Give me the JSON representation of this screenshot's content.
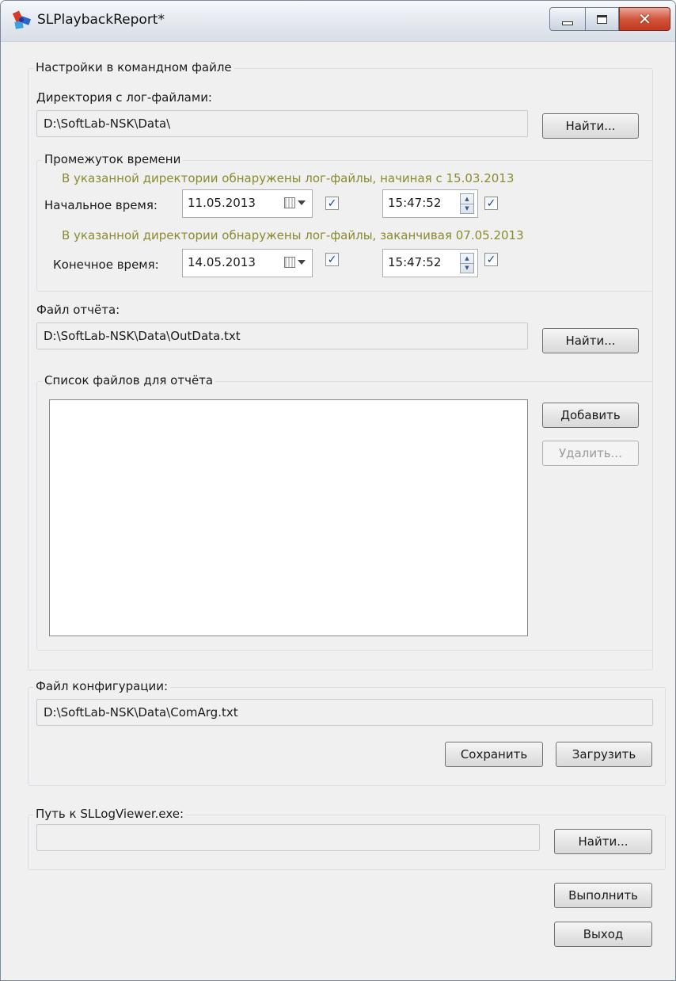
{
  "window": {
    "title": "SLPlaybackReport*"
  },
  "command_settings": {
    "legend": "Настройки в командном файле",
    "log_dir_label": "Директория с лог-файлами:",
    "log_dir_value": "D:\\SoftLab-NSK\\Data\\",
    "log_dir_browse": "Найти...",
    "time_range": {
      "legend": "Промежуток времени",
      "start_hint": "В указанной директории обнаружены лог-файлы, начиная с 15.03.2013",
      "start_label": "Начальное время:",
      "start_date": "11.05.2013",
      "start_date_checked": true,
      "start_time": "15:47:52",
      "start_time_checked": true,
      "end_hint": "В указанной директории обнаружены лог-файлы, заканчивая 07.05.2013",
      "end_label": "Конечное время:",
      "end_date": "14.05.2013",
      "end_date_checked": true,
      "end_time": "15:47:52",
      "end_time_checked": true
    },
    "report_file_label": "Файл отчёта:",
    "report_file_value": "D:\\SoftLab-NSK\\Data\\OutData.txt",
    "report_file_browse": "Найти...",
    "file_list": {
      "legend": "Список файлов для отчёта",
      "items": [],
      "add_label": "Добавить",
      "remove_label": "Удалить..."
    }
  },
  "config": {
    "legend": "Файл конфигурации:",
    "value": "D:\\SoftLab-NSK\\Data\\ComArg.txt",
    "save_label": "Сохранить",
    "load_label": "Загрузить"
  },
  "viewer": {
    "legend": "Путь к SLLogViewer.exe:",
    "value": "",
    "browse_label": "Найти..."
  },
  "actions": {
    "run_label": "Выполнить",
    "exit_label": "Выход"
  },
  "colors": {
    "hint_text": "#8a8a2e",
    "checkmark": "#1f3f84",
    "close_button": "#c0391f"
  }
}
